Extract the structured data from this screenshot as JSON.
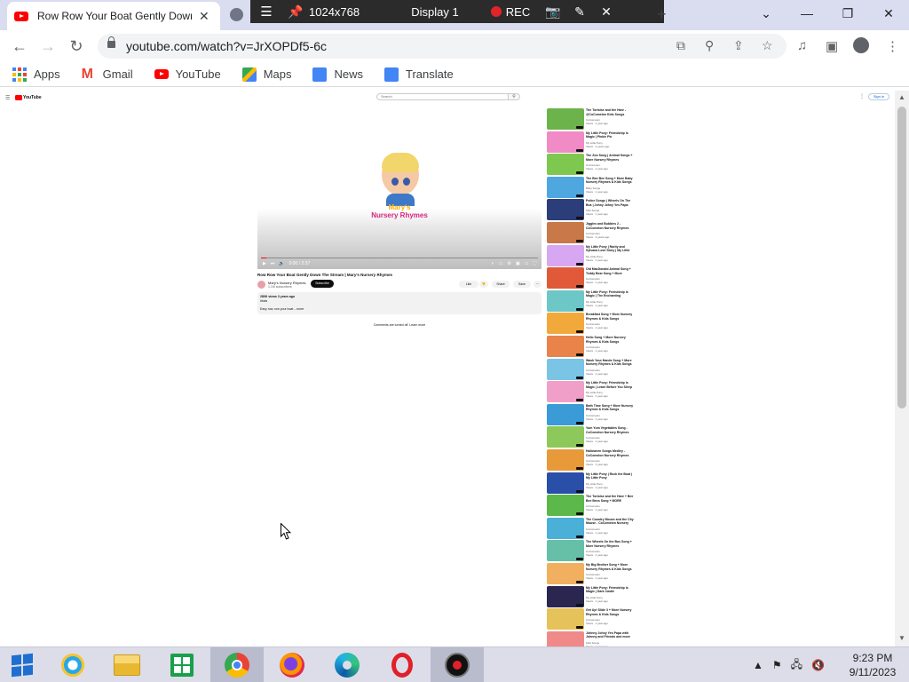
{
  "browser": {
    "tab_title": "Row Row Your Boat Gently Down",
    "tab_close": "✕",
    "new_tab": "+",
    "url": "youtube.com/watch?v=JrXOPDf5-6c",
    "window_controls": {
      "minimize": "⌄",
      "minimize2": "—",
      "restore": "❐",
      "close": "✕"
    },
    "nav": {
      "back": "←",
      "forward": "→",
      "reload": "↻"
    },
    "bookmarks": [
      {
        "label": "Apps"
      },
      {
        "label": "Gmail"
      },
      {
        "label": "YouTube"
      },
      {
        "label": "Maps"
      },
      {
        "label": "News"
      },
      {
        "label": "Translate"
      }
    ]
  },
  "recorder": {
    "resolution": "1024x768",
    "display": "Display 1",
    "rec_label": "REC",
    "menu_glyph": "☰",
    "pin_glyph": "📌",
    "camera_glyph": "📷",
    "pen_glyph": "✎",
    "close_glyph": "✕"
  },
  "youtube": {
    "logo_text": "YouTube",
    "search_placeholder": "Search",
    "signin_label": "Sign in",
    "player": {
      "channel_logo_line1": "Mary's",
      "channel_logo_line2": "Nursery Rhymes",
      "time": "0:00 / 2:37",
      "progress": 0.02
    },
    "video_title": "Row Row Your Boat Gently Down The Stream | Mary's Nursery Rhymes",
    "channel_name": "Mary's Nursery Rhymes",
    "channel_subs": "1.1M subscribers",
    "subscribe_label": "Subscribe",
    "actions": {
      "like": "Like",
      "share": "Share",
      "save": "Save"
    },
    "description": {
      "views": "280K views  3 years ago",
      "tags": "#kids",
      "text": "Easy row, row your boat ...more"
    },
    "comments_note": "Comments are turned off. Learn more",
    "related": [
      {
        "title": "The Tortoise and the Hare - @CoComelon Kids Songs",
        "channel": "CoComelon",
        "meta": "Views · 1 year ago",
        "color": "#6bb34a"
      },
      {
        "title": "My Little Pony: Friendship is Magic | Pinkie Pie",
        "channel": "My Little Pony",
        "meta": "Views · 2 years ago",
        "color": "#f08bc6"
      },
      {
        "title": "The Zoo Song | Animal Songs + More Nursery Rhymes",
        "channel": "CoComelon",
        "meta": "Views · 1 year ago",
        "color": "#7ec850"
      },
      {
        "title": "The Bee Bee Song + More Baby Nursery Rhymes & Kids Songs",
        "channel": "Baby Songs",
        "meta": "Views · 1 year ago",
        "color": "#4fa7e0"
      },
      {
        "title": "Police Songs | Wheels On The Bus | Johny Johny Yes Papa",
        "channel": "Kids Songs",
        "meta": "Views · 1 year ago",
        "color": "#2c3e7a"
      },
      {
        "title": "Jiggles and Bubbles 2 - CoComelon Nursery Rhymes",
        "channel": "CoComelon",
        "meta": "Views · 2 years ago",
        "color": "#c9784a"
      },
      {
        "title": "My Little Pony | Rarity and Sylvana Love Story | My Little Pony",
        "channel": "My Little Pony",
        "meta": "Views · 1 year ago",
        "color": "#d8a7f2"
      },
      {
        "title": "Old MacDonald Animal Song + Teddy Bear Song + More",
        "channel": "CoComelon",
        "meta": "Views · 1 year ago",
        "color": "#e05a3a"
      },
      {
        "title": "My Little Pony: Friendship is Magic | The Enchanting",
        "channel": "My Little Pony",
        "meta": "Views · 1 year ago",
        "color": "#6ec7c7"
      },
      {
        "title": "Breakfast Song + More Nursery Rhymes & Kids Songs",
        "channel": "CoComelon",
        "meta": "Views · 1 year ago",
        "color": "#f2a93b"
      },
      {
        "title": "Hello Song + More Nursery Rhymes & Kids Songs",
        "channel": "CoComelon",
        "meta": "Views · 1 year ago",
        "color": "#e8844a"
      },
      {
        "title": "Wash Your Hands Song + More Nursery Rhymes & Kids Songs",
        "channel": "CoComelon",
        "meta": "Views · 1 year ago",
        "color": "#7ac4e6"
      },
      {
        "title": "My Little Pony: Friendship is Magic | Learn Before You Sleep",
        "channel": "My Little Pony",
        "meta": "Views · 1 year ago",
        "color": "#f0a0c8"
      },
      {
        "title": "Bath Time Song + More Nursery Rhymes & Kids Songs",
        "channel": "CoComelon",
        "meta": "Views · 1 year ago",
        "color": "#3a9bd6"
      },
      {
        "title": "Yum Yum Vegetables Song - CoComelon Nursery Rhymes",
        "channel": "CoComelon",
        "meta": "Views · 1 year ago",
        "color": "#8dc85a"
      },
      {
        "title": "Halloween Songs Medley - CoComelon Nursery Rhymes",
        "channel": "CoComelon",
        "meta": "Views · 1 year ago",
        "color": "#e89a3a"
      },
      {
        "title": "My Little Pony | Rock the Boat | My Little Pony",
        "channel": "My Little Pony",
        "meta": "Views · 1 year ago",
        "color": "#2a4fa8"
      },
      {
        "title": "The Tortoise and the Hare + Bee Bee Bees Song + MORE",
        "channel": "CoComelon",
        "meta": "Views · 1 year ago",
        "color": "#5cb84a"
      },
      {
        "title": "The Country Mouse and the City Mouse - CoComelon Nursery",
        "channel": "CoComelon",
        "meta": "Views · 1 year ago",
        "color": "#4ab0d8"
      },
      {
        "title": "The Wheels On the Bus Song + More Nursery Rhymes",
        "channel": "CoComelon",
        "meta": "Views · 1 year ago",
        "color": "#66c0a8"
      },
      {
        "title": "My Big Brother Song + More Nursery Rhymes & Kids Songs",
        "channel": "CoComelon",
        "meta": "Views · 1 year ago",
        "color": "#f0b060"
      },
      {
        "title": "My Little Pony: Friendship is Magic | Dark Castle",
        "channel": "My Little Pony",
        "meta": "Views · 1 year ago",
        "color": "#2a2650"
      },
      {
        "title": "Get Up! Slide 3 + More Nursery Rhymes & Kids Songs",
        "channel": "CoComelon",
        "meta": "Views · 1 year ago",
        "color": "#e6c25a"
      },
      {
        "title": "Johnny Johny Yes Papa with Johnny and Friends and more",
        "channel": "Kids Songs",
        "meta": "Views · 1 year ago",
        "color": "#f08a8a"
      }
    ]
  },
  "taskbar": {
    "time": "9:23 PM",
    "date": "9/11/2023",
    "tray": [
      "▲",
      "⚑",
      "🖧",
      "🔇"
    ]
  }
}
